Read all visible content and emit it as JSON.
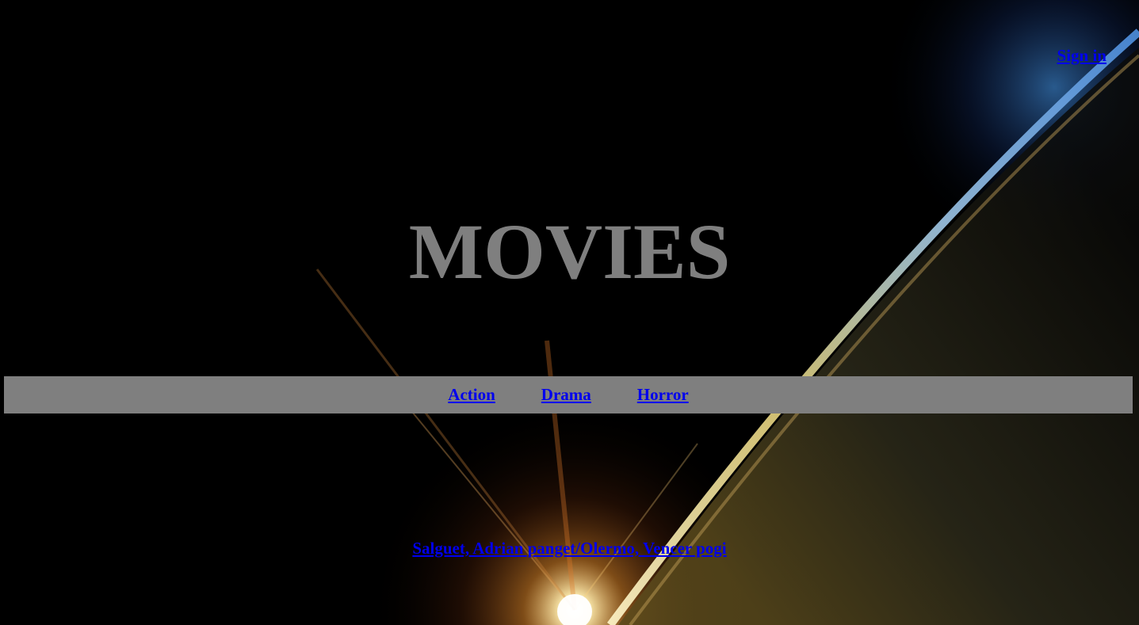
{
  "header": {
    "signin_label": "Sign in"
  },
  "hero": {
    "title": "MOVIES"
  },
  "nav": {
    "items": [
      {
        "label": "Action"
      },
      {
        "label": "Drama"
      },
      {
        "label": "Horror"
      }
    ]
  },
  "footer": {
    "credits_label": "Salguet, Adrian panget/Olermo, Vencer pogi"
  },
  "colors": {
    "background": "#000000",
    "title": "#7f7f7f",
    "navbar": "#7f7f7f",
    "link": "#0000ee"
  }
}
